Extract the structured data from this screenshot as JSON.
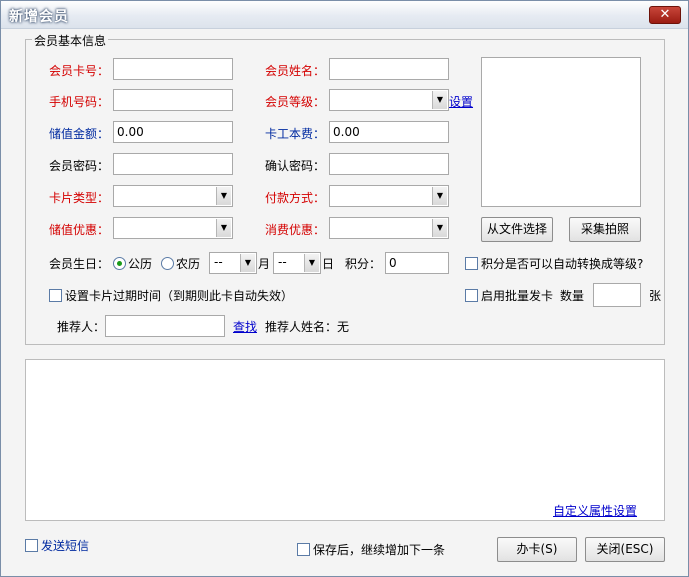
{
  "window": {
    "title": "新增会员",
    "close_label": "✕"
  },
  "group_basic": {
    "legend": "会员基本信息"
  },
  "fields": {
    "card_no": {
      "label": "会员卡号："
    },
    "name": {
      "label": "会员姓名："
    },
    "phone": {
      "label": "手机号码："
    },
    "level": {
      "label": "会员等级：",
      "value": ""
    },
    "stored_amount": {
      "label": "储值金额：",
      "value": "0.00"
    },
    "card_fee": {
      "label": "卡工本费：",
      "value": "0.00"
    },
    "password": {
      "label": "会员密码："
    },
    "confirm_password": {
      "label": "确认密码："
    },
    "card_type": {
      "label": "卡片类型：",
      "value": ""
    },
    "payment_method": {
      "label": "付款方式：",
      "value": ""
    },
    "stored_discount": {
      "label": "储值优惠：",
      "value": ""
    },
    "consume_discount": {
      "label": "消费优惠：",
      "value": ""
    },
    "birthday": {
      "label": "会员生日：",
      "gregorian_label": "公历",
      "lunar_label": "农历",
      "month_value": "--",
      "month_unit": "月",
      "day_value": "--",
      "day_unit": "日"
    },
    "points": {
      "label": "积分：",
      "value": "0"
    },
    "referrer": {
      "label": "推荐人：",
      "value": ""
    },
    "referrer_name": {
      "label": "推荐人姓名：无"
    }
  },
  "links": {
    "settings": "设置",
    "search": "查找",
    "custom_attr": "自定义属性设置"
  },
  "checkboxes": {
    "points_to_level": "积分是否可以自动转换成等级?",
    "expiry": "设置卡片过期时间（到期则此卡自动失效）",
    "batch": "启用批量发卡",
    "send_sms": "发送短信",
    "save_continue": "保存后，继续增加下一条"
  },
  "batch": {
    "qty_label": "数量",
    "qty_value": "",
    "unit": "张"
  },
  "buttons": {
    "from_file": "从文件选择",
    "capture_photo": "采集拍照",
    "submit": "办卡(S)",
    "close": "关闭(ESC)"
  },
  "colors": {
    "required_label": "#d40000",
    "money_label": "#002aa0",
    "link": "#0000cc"
  }
}
